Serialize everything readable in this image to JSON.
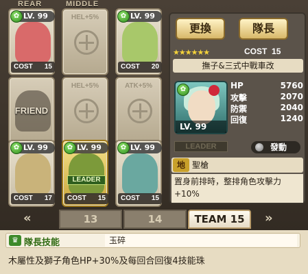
{
  "columns": {
    "rear": "REAR",
    "middle": "MIDDLE"
  },
  "slots": [
    {
      "type": "char",
      "lv": "LV. 99",
      "cost_label": "COST",
      "cost": "15",
      "color": "#d96a6a"
    },
    {
      "type": "empty",
      "label": "HEL+5%"
    },
    {
      "type": "char",
      "lv": "LV. 99",
      "cost_label": "COST",
      "cost": "20",
      "color": "#a8c86a"
    },
    {
      "type": "friend",
      "label": "FRIEND"
    },
    {
      "type": "empty",
      "label": "HEL+5%"
    },
    {
      "type": "empty",
      "label": "ATK+5%"
    },
    {
      "type": "char",
      "lv": "LV. 99",
      "cost_label": "COST",
      "cost": "17",
      "color": "#c9b37a"
    },
    {
      "type": "leader",
      "lv": "LV. 99",
      "cost_label": "COST",
      "cost": "15",
      "badge": "LEADER",
      "color": "#7c9a3a"
    },
    {
      "type": "char",
      "lv": "LV. 99",
      "cost_label": "COST",
      "cost": "15",
      "color": "#6aa8a0"
    }
  ],
  "buttons": {
    "swap": "更換",
    "captain": "隊長"
  },
  "rarity_stars": "★★★★★★",
  "cost": {
    "label": "COST",
    "value": "15"
  },
  "char_name": "撫子&三式中戰車改",
  "portrait_lv": "LV. 99",
  "stats": [
    {
      "label": "HP",
      "value": "5760"
    },
    {
      "label": "攻擊",
      "value": "2070"
    },
    {
      "label": "防禦",
      "value": "2040"
    },
    {
      "label": "回復",
      "value": "1240"
    }
  ],
  "leader_tag": "LEADER",
  "activate": "發動",
  "skill": {
    "icon": "地",
    "name": "聖槍",
    "desc": "置身前排時，整排角色攻擊力+10%"
  },
  "tabs": [
    "13",
    "14",
    "TEAM 15"
  ],
  "leader_skill": {
    "icon": "♛",
    "title": "隊長技能",
    "name": "玉碎",
    "desc": "木屬性及獅子角色HP+30%及每回合回復4技能珠"
  }
}
